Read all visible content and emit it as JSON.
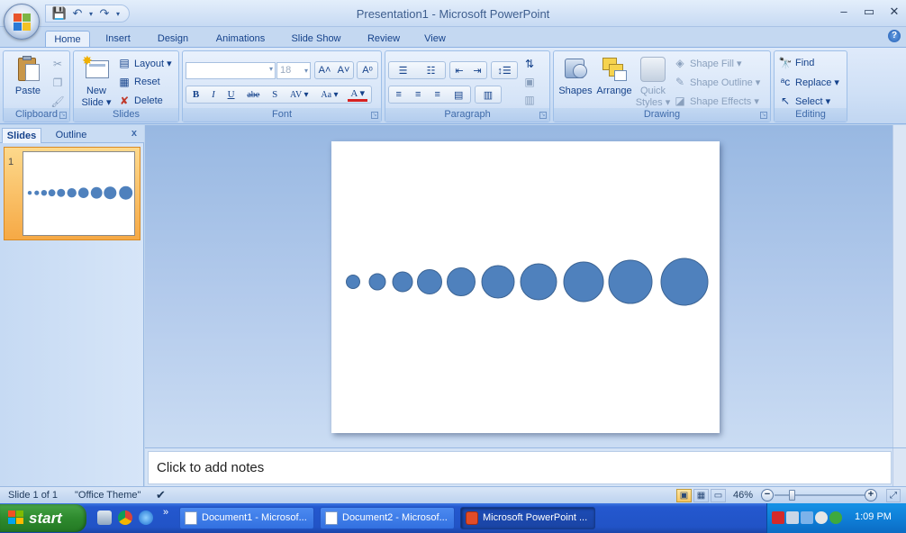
{
  "window": {
    "title": "Presentation1 - Microsoft PowerPoint",
    "controls": {
      "minimize": "–",
      "restore": "▭",
      "close": "✕"
    }
  },
  "quick_access": {
    "save_icon": "💾",
    "undo_icon": "↶",
    "redo_icon": "↷",
    "dropdown_icon": "▾"
  },
  "tabs": [
    "Home",
    "Insert",
    "Design",
    "Animations",
    "Slide Show",
    "Review",
    "View"
  ],
  "ribbon": {
    "clipboard": {
      "label": "Clipboard",
      "paste": "Paste"
    },
    "slides": {
      "label": "Slides",
      "new_slide_1": "New",
      "new_slide_2": "Slide ▾",
      "layout": "Layout ▾",
      "reset": "Reset",
      "delete": "Delete"
    },
    "font": {
      "label": "Font",
      "font_name": "",
      "font_size": "18",
      "grow": "A˄",
      "shrink": "A˅",
      "clear": "Aᵒ",
      "bold": "B",
      "italic": "I",
      "underline": "U",
      "strike": "abe",
      "shadow": "S",
      "spacing": "AV ▾",
      "case": "Aa ▾",
      "color": "A ▾"
    },
    "paragraph": {
      "label": "Paragraph"
    },
    "drawing": {
      "label": "Drawing",
      "shapes": "Shapes",
      "arrange": "Arrange",
      "quick_styles_1": "Quick",
      "quick_styles_2": "Styles ▾",
      "shape_fill": "Shape Fill ▾",
      "shape_outline": "Shape Outline ▾",
      "shape_effects": "Shape Effects ▾"
    },
    "editing": {
      "label": "Editing",
      "find": "Find",
      "replace": "Replace ▾",
      "select": "Select ▾"
    }
  },
  "left_panel": {
    "tab_slides": "Slides",
    "tab_outline": "Outline",
    "close": "x",
    "slide_number": "1"
  },
  "slide": {
    "circle_color": "#4f81bd",
    "circle_stroke": "#3c6494",
    "circle_count": 10
  },
  "notes": {
    "placeholder": "Click to add notes"
  },
  "status": {
    "slide_info": "Slide 1 of 1",
    "theme": "\"Office Theme\"",
    "zoom": "46%"
  },
  "taskbar": {
    "start": "start",
    "more": "»",
    "tasks": [
      "Document1 - Microsof...",
      "Document2 - Microsof...",
      "Microsoft PowerPoint ..."
    ],
    "clock": "1:09 PM"
  }
}
